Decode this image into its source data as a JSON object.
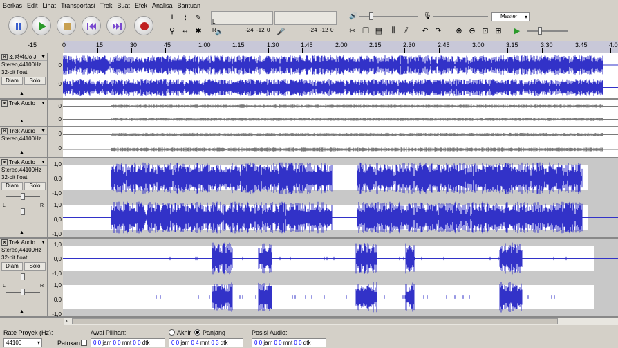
{
  "menu": [
    "Berkas",
    "Edit",
    "Lihat",
    "Transportasi",
    "Trek",
    "Buat",
    "Efek",
    "Analisa",
    "Bantuan"
  ],
  "toolbar": {
    "meter_left_ticks": [
      "-24",
      "-12",
      "0"
    ],
    "meter_right_ticks": [
      "-24",
      "-12",
      "0"
    ],
    "output_device": "Master",
    "meter_L": "L",
    "meter_R": "R"
  },
  "ruler": {
    "labels": [
      "-15",
      "0",
      "15",
      "30",
      "45",
      "1:00",
      "1:15",
      "1:30",
      "1:45",
      "2:00",
      "2:15",
      "2:30",
      "2:45",
      "3:00",
      "3:15",
      "3:30",
      "3:45",
      "4:00"
    ]
  },
  "tracks": [
    {
      "name": "조정석(Jo J",
      "lines": [
        "Stereo,44100Hz",
        "32-bit float"
      ],
      "buttons": [
        "Diam",
        "Solo"
      ],
      "scales": [
        "0",
        "0"
      ]
    },
    {
      "name": "Trek Audio",
      "lines": [],
      "buttons": [],
      "scales": [
        "0",
        "0"
      ]
    },
    {
      "name": "Trek Audio",
      "lines": [
        "Stereo,44100Hz"
      ],
      "buttons": [],
      "scales": [
        "0",
        "0"
      ]
    },
    {
      "name": "Trek Audio",
      "lines": [
        "Stereo,44100Hz",
        "32-bit float"
      ],
      "buttons": [
        "Diam",
        "Solo"
      ],
      "scales": [
        "1,0",
        "0,0",
        "-1,0",
        "1,0",
        "0,0",
        "-1,0"
      ],
      "pan_L": "L",
      "pan_R": "R"
    },
    {
      "name": "Trek Audio",
      "lines": [
        "Stereo,44100Hz",
        "32-bit float"
      ],
      "buttons": [
        "Diam",
        "Solo"
      ],
      "scales": [
        "1,0",
        "0,0",
        "-1,0",
        "1,0",
        "0,0",
        "-1,0"
      ],
      "pan_L": "L",
      "pan_R": "R"
    }
  ],
  "selection_bar": {
    "rate_label": "Rate Proyek (Hz):",
    "rate_value": "44100",
    "snap_label": "Patokan",
    "start_label": "Awal Pilihan:",
    "end_option": "Akhir",
    "length_option": "Panjang",
    "start_value": "0 0 jam 0 0 mnt 0 0 dtk",
    "length_value": "0 0 jam 0 4 mnt 0 3 dtk",
    "pos_label": "Posisi Audio:",
    "pos_value": "0 0 jam 0 0 mnt 0 0 dtk",
    "start_value_parts": [
      "0 0",
      "jam",
      "0 0",
      "mnt",
      "0 0",
      "dtk"
    ],
    "length_value_parts": [
      "0 0",
      "jam",
      "0 4",
      "mnt",
      "0 3",
      "dtk"
    ],
    "pos_value_parts": [
      "0 0",
      "jam",
      "0 0",
      "mnt",
      "0 0",
      "dtk"
    ]
  },
  "colors": {
    "wave_blue": "#3232c8",
    "wave_gray": "#7a7a7a",
    "play_green": "#2a9a2a",
    "record_red": "#c02020"
  }
}
